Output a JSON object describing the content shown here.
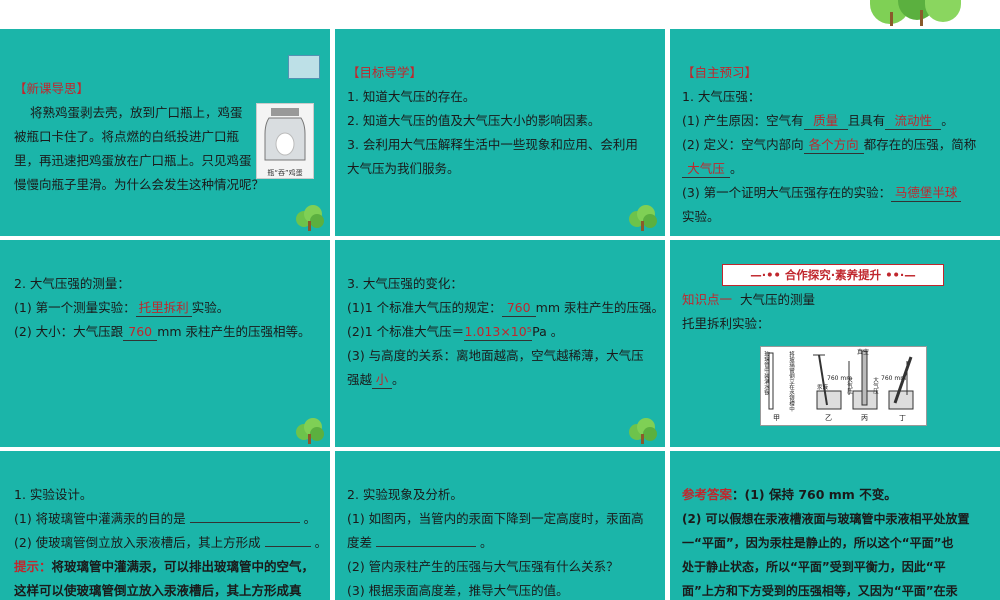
{
  "s1": {
    "title": "【新课导思】",
    "lines": [
      "将熟鸡蛋剥去壳，放到广口瓶上，鸡蛋",
      "被瓶口卡住了。将点燃的白纸投进广口瓶",
      "里，再迅速把鸡蛋放在广口瓶上。只见鸡蛋",
      "慢慢向瓶子里滑。为什么会发生这种情况呢？"
    ],
    "caption": "瓶“吞”鸡蛋"
  },
  "s2": {
    "title": "【目标导学】",
    "lines": [
      "1. 知道大气压的存在。",
      "2. 知道大气压的值及大气压大小的影响因素。",
      "3. 会利用大气压解释生活中一些现象和应用、会利用",
      "大气压为我们服务。"
    ]
  },
  "s3": {
    "title": "【自主预习】",
    "l1": "1. 大气压强：",
    "l2a": "(1) 产生原因：空气有",
    "a1": "质量",
    "l2b": "且具有",
    "a2": "流动性",
    "l2c": "。",
    "l3a": "(2) 定义：空气内部向",
    "a3": "各个方向",
    "l3b": "都存在的压强，简称",
    "a4": "大气压",
    "l4b": "。",
    "l5a": "(3) 第一个证明大气压强存在的实验：",
    "a5": "马德堡半球",
    "l6": "实验。"
  },
  "s4": {
    "l1": "2. 大气压强的测量：",
    "l2a": "(1) 第一个测量实验：",
    "a1": "托里拆利",
    "l2b": "实验。",
    "l3a": "(2) 大小：大气压跟",
    "a2": "760",
    "l3b": "mm 汞柱产生的压强相等。"
  },
  "s5": {
    "l1": "3. 大气压强的变化：",
    "l2a": "(1)1 个标准大气压的规定：",
    "a1": "760",
    "l2b": "mm 汞柱产生的压强。",
    "l3a": "(2)1 个标准大气压＝",
    "a2": "1.013×10⁵",
    "l3b": "Pa 。",
    "l4": "(3) 与高度的关系：离地面越高，空气越稀薄，大气压",
    "l5a": "强越",
    "a3": "小",
    "l5b": "。"
  },
  "s6": {
    "banner": "合作探究·素养提升",
    "l1a": "知识点一",
    "l1b": "大气压的测量",
    "l2": "托里拆利实验：",
    "figure": {
      "labels": [
        "甲",
        "乙",
        "丙",
        "丁"
      ],
      "vac": "真空",
      "h1": "760 mm",
      "h2": "760 mm",
      "t1": "玻璃管中装满水银",
      "t2": "将玻璃管倒立在水银槽中",
      "t3": "大气压",
      "t4": "大气压",
      "t5": "汞液"
    }
  },
  "s7": {
    "l1": "1. 实验设计。",
    "l2": "(1) 将玻璃管中灌满汞的目的是",
    "l2end": "。",
    "l3": "(2) 使玻璃管倒立放入汞液槽后，其上方形成",
    "l3end": "。",
    "tip_label": "提示：",
    "tip1": "将玻璃管中灌满汞，可以排出玻璃管中的空气，",
    "tip2": "这样可以使玻璃管倒立放入汞液槽后，其上方形成真"
  },
  "s8": {
    "l1": "2. 实验现象及分析。",
    "l2": "(1) 如图丙，当管内的汞面下降到一定高度时，汞面高",
    "l3": "度差",
    "l3end": "。",
    "l4": "(2) 管内汞柱产生的压强与大气压强有什么关系？",
    "l5": "(3) 根据汞面高度差，推导大气压的值。"
  },
  "s9": {
    "label": "参考答案",
    "l1": "：(1) 保持 760 mm 不变。",
    "l2": "(2) 可以假想在汞液槽液面与玻璃管中汞液相平处放置",
    "l3": "一“平面”，因为汞柱是静止的，所以这个“平面”也",
    "l4": "处于静止状态，所以“平面”受到平衡力，因此“平",
    "l5": "面”上方和下方受到的压强相等，又因为“平面”在汞"
  }
}
